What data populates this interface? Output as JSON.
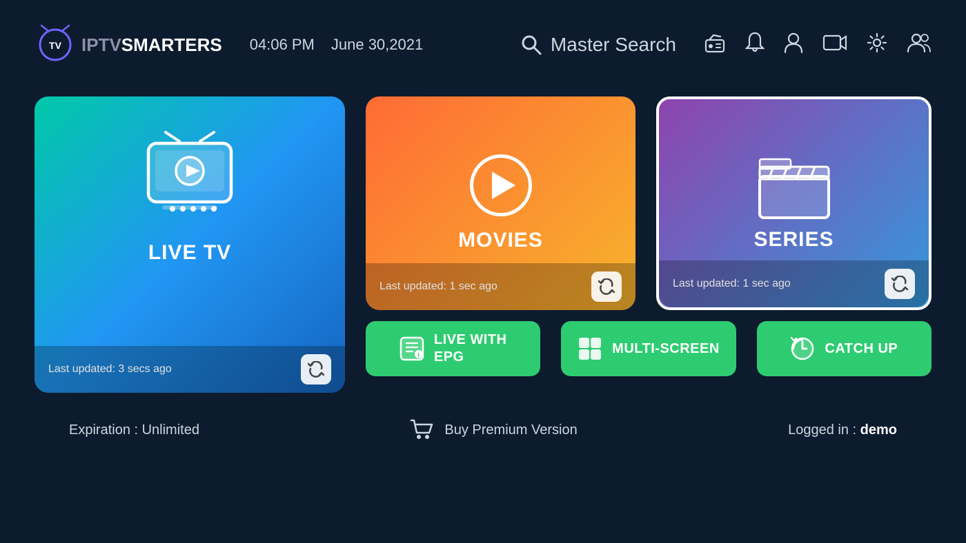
{
  "header": {
    "logo_text_iptv": "IPTV",
    "logo_text_smarters": "SMARTERS",
    "time": "04:06 PM",
    "date": "June 30,2021",
    "search_label": "Master Search",
    "nav_icons": [
      "radio-icon",
      "bell-icon",
      "user-icon",
      "record-icon",
      "settings-icon",
      "users-icon"
    ]
  },
  "cards": {
    "live_tv": {
      "label": "LIVE TV",
      "last_updated": "Last updated: 3 secs ago"
    },
    "movies": {
      "label": "MOVIES",
      "last_updated": "Last updated: 1 sec ago"
    },
    "series": {
      "label": "SERIES",
      "last_updated": "Last updated: 1 sec ago"
    }
  },
  "small_cards": {
    "live_epg": {
      "label": "LIVE WITH\nEPG",
      "label_line1": "LIVE WITH",
      "label_line2": "EPG"
    },
    "multi_screen": {
      "label": "MULTI-SCREEN"
    },
    "catch_up": {
      "label": "CATCH UP"
    }
  },
  "footer": {
    "expiry": "Expiration : Unlimited",
    "premium_label": "Buy Premium Version",
    "logged_in_prefix": "Logged in : ",
    "logged_in_user": "demo"
  }
}
